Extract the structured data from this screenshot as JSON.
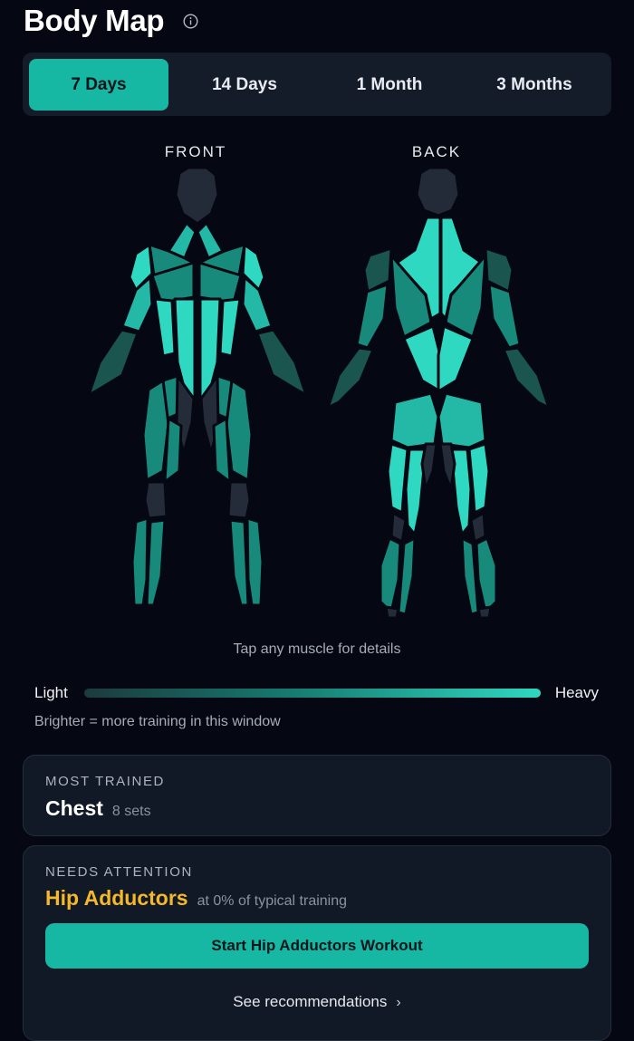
{
  "header": {
    "title": "Body Map",
    "info_icon": "info-icon"
  },
  "tabs": [
    {
      "label": "7 Days",
      "active": true
    },
    {
      "label": "14 Days",
      "active": false
    },
    {
      "label": "1 Month",
      "active": false
    },
    {
      "label": "3 Months",
      "active": false
    }
  ],
  "body_map": {
    "front_label": "FRONT",
    "back_label": "BACK",
    "hint": "Tap any muscle for details",
    "intensity_colors": {
      "high": "#2fd8c0",
      "medium_high": "#23b9a6",
      "medium": "#178a7c",
      "low": "#1a564f",
      "very_low": "#163d3a",
      "none": "#242c3a",
      "head": "#232a38"
    }
  },
  "legend": {
    "light_label": "Light",
    "heavy_label": "Heavy",
    "note": "Brighter = more training in this window"
  },
  "most_trained": {
    "kicker": "MOST TRAINED",
    "muscle": "Chest",
    "detail": "8 sets"
  },
  "needs_attention": {
    "kicker": "NEEDS ATTENTION",
    "muscle": "Hip Adductors",
    "detail": "at 0% of typical training",
    "cta_label": "Start Hip Adductors Workout",
    "recommendations_label": "See recommendations"
  }
}
